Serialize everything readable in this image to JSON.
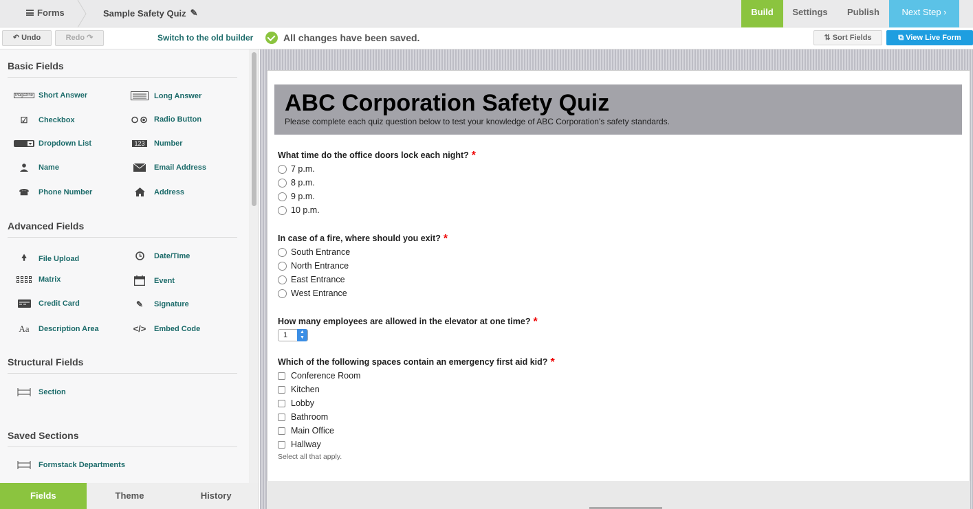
{
  "topbar": {
    "forms_label": "Forms",
    "form_title": "Sample Safety Quiz",
    "nav": {
      "build": "Build",
      "settings": "Settings",
      "publish": "Publish",
      "next_step": "Next Step ›"
    },
    "build_color": "#8bc43f",
    "next_color": "#5bc2e7"
  },
  "toolbar": {
    "undo": "↶ Undo",
    "redo": "Redo ↷",
    "old_builder": "Switch to the old builder",
    "saved_status": "All changes have been saved.",
    "sort_fields": "⇅ Sort Fields",
    "view_live": "⧉ View Live Form"
  },
  "sidebar": {
    "basic_title": "Basic Fields",
    "basic": [
      {
        "label": "Short Answer",
        "icon": "short-answer-icon"
      },
      {
        "label": "Long Answer",
        "icon": "long-answer-icon"
      },
      {
        "label": "Checkbox",
        "icon": "checkbox-icon"
      },
      {
        "label": "Radio Button",
        "icon": "radio-button-icon"
      },
      {
        "label": "Dropdown List",
        "icon": "dropdown-icon"
      },
      {
        "label": "Number",
        "icon": "number-icon"
      },
      {
        "label": "Name",
        "icon": "person-icon"
      },
      {
        "label": "Email Address",
        "icon": "envelope-icon"
      },
      {
        "label": "Phone Number",
        "icon": "phone-icon"
      },
      {
        "label": "Address",
        "icon": "house-icon"
      }
    ],
    "advanced_title": "Advanced Fields",
    "advanced": [
      {
        "label": "File Upload",
        "icon": "upload-icon"
      },
      {
        "label": "Date/Time",
        "icon": "clock-icon"
      },
      {
        "label": "Matrix",
        "icon": "matrix-icon"
      },
      {
        "label": "Event",
        "icon": "calendar-icon"
      },
      {
        "label": "Credit Card",
        "icon": "credit-card-icon"
      },
      {
        "label": "Signature",
        "icon": "pen-icon"
      },
      {
        "label": "Description Area",
        "icon": "text-icon"
      },
      {
        "label": "Embed Code",
        "icon": "code-icon"
      }
    ],
    "structural_title": "Structural Fields",
    "structural": [
      {
        "label": "Section",
        "icon": "section-icon"
      }
    ],
    "saved_title": "Saved Sections",
    "saved": [
      {
        "label": "Formstack Departments",
        "icon": "section-icon"
      }
    ],
    "icon_text": {
      "short_answer": "Magazine",
      "number": "123"
    },
    "tabs": {
      "fields": "Fields",
      "theme": "Theme",
      "history": "History"
    }
  },
  "form": {
    "title": "ABC Corporation Safety Quiz",
    "subtitle": "Please complete each quiz question below to test your knowledge of ABC Corporation's safety standards.",
    "required_mark": "*",
    "q1": {
      "label": "What time do the office doors lock each night?",
      "options": [
        "7 p.m.",
        "8 p.m.",
        "9 p.m.",
        "10 p.m."
      ]
    },
    "q2": {
      "label": "In case of a fire, where should you exit?",
      "options": [
        "South Entrance",
        "North Entrance",
        "East Entrance",
        "West Entrance"
      ]
    },
    "q3": {
      "label": "How many employees are allowed in the elevator at one time?",
      "value": "1"
    },
    "q4": {
      "label": "Which of the following spaces contain an emergency first aid kid?",
      "options": [
        "Conference Room",
        "Kitchen",
        "Lobby",
        "Bathroom",
        "Main Office",
        "Hallway"
      ],
      "help": "Select all that apply."
    }
  }
}
